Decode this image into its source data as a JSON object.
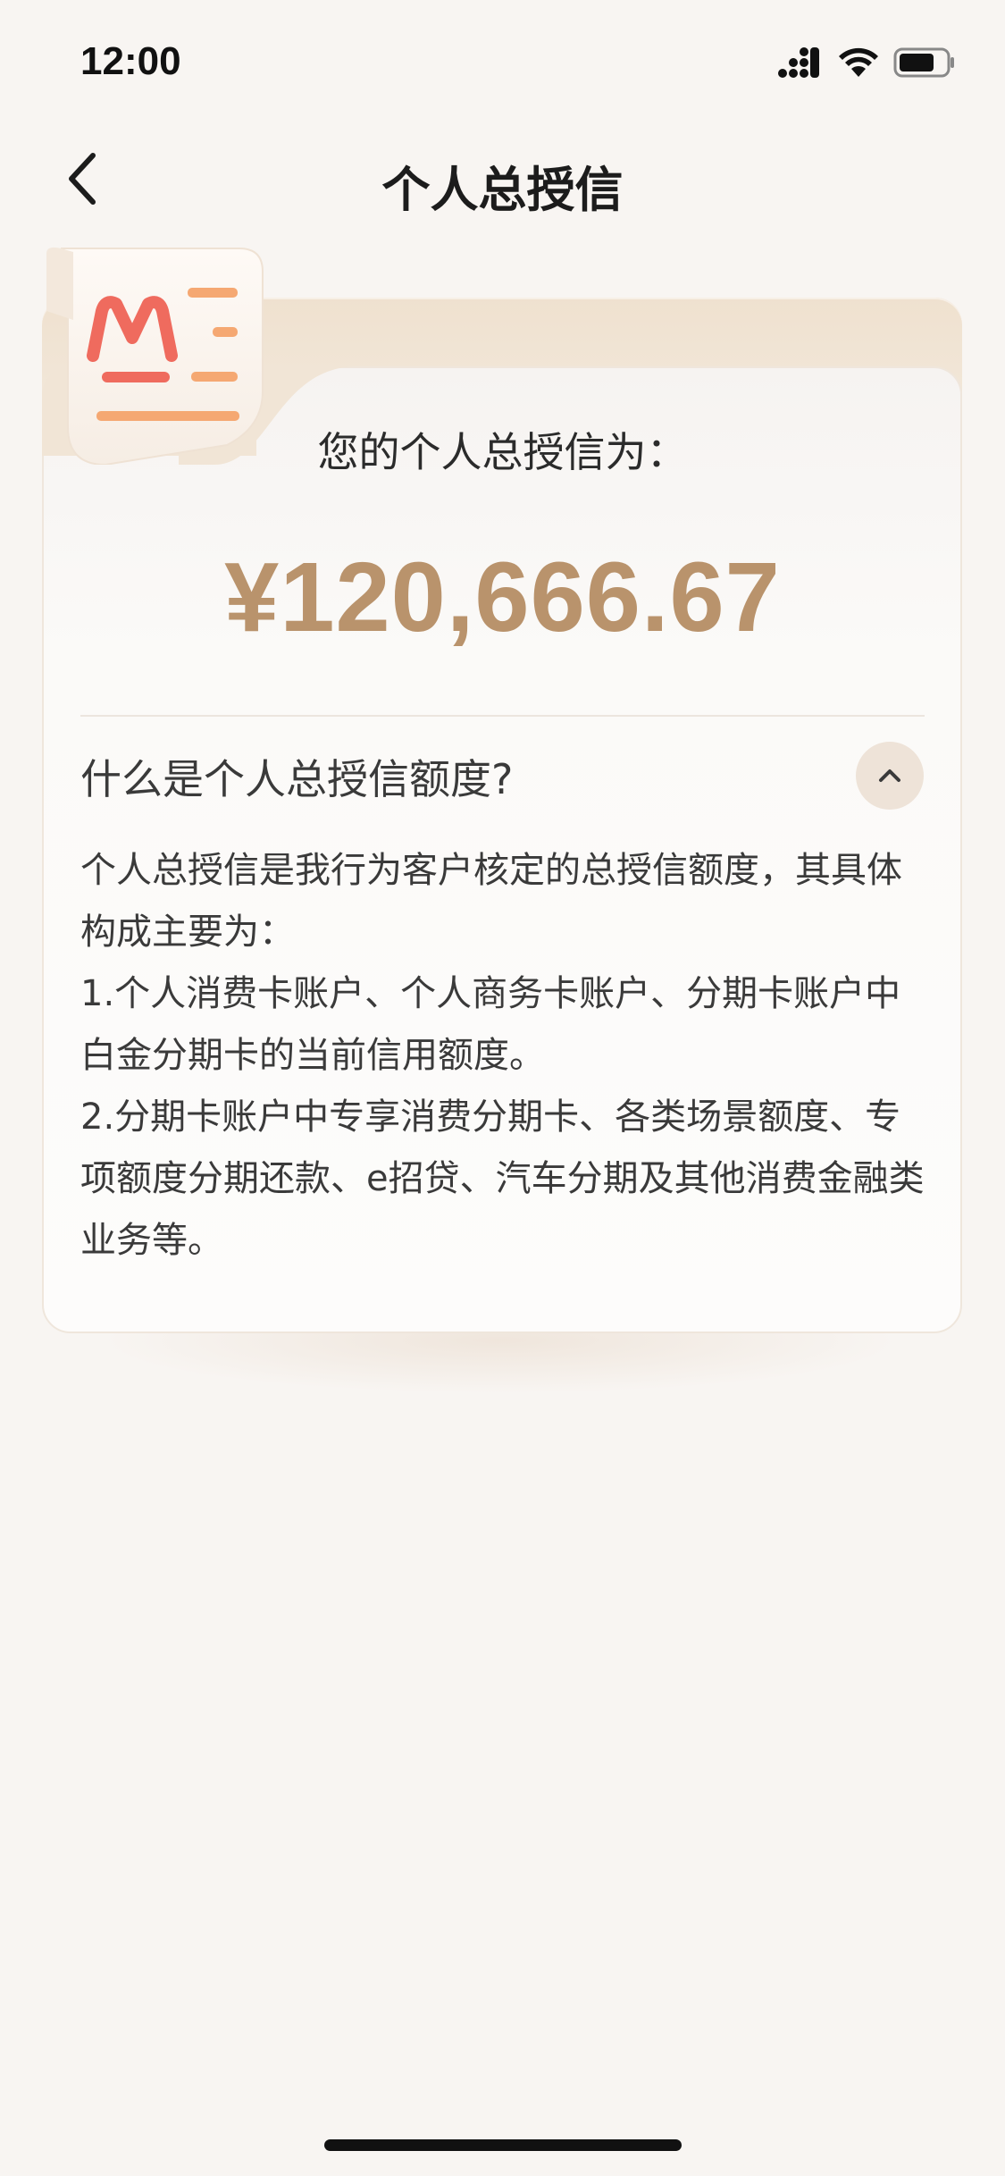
{
  "status_bar": {
    "time": "12:00"
  },
  "nav": {
    "title": "个人总授信",
    "back_icon": "chevron-left-icon"
  },
  "card": {
    "label": "您的个人总授信为：",
    "amount": "¥120,666.67",
    "faq": {
      "question": "什么是个人总授信额度?",
      "collapse_icon": "chevron-up-icon",
      "expanded": true,
      "answer": {
        "intro": "个人总授信是我行为客户核定的总授信额度，其具体构成主要为：",
        "item_1": "1.个人消费卡账户、个人商务卡账户、分期卡账户中白金分期卡的当前信用额度。",
        "item_2": "2.分期卡账户中专享消费分期卡、各类场景额度、专项额度分期还款、e招贷、汽车分期及其他消费金融类业务等。"
      }
    }
  },
  "colors": {
    "background": "#f8f5f2",
    "amount": "#b9936c",
    "badge_red": "#ef6b5e",
    "badge_orange": "#f5a872"
  }
}
